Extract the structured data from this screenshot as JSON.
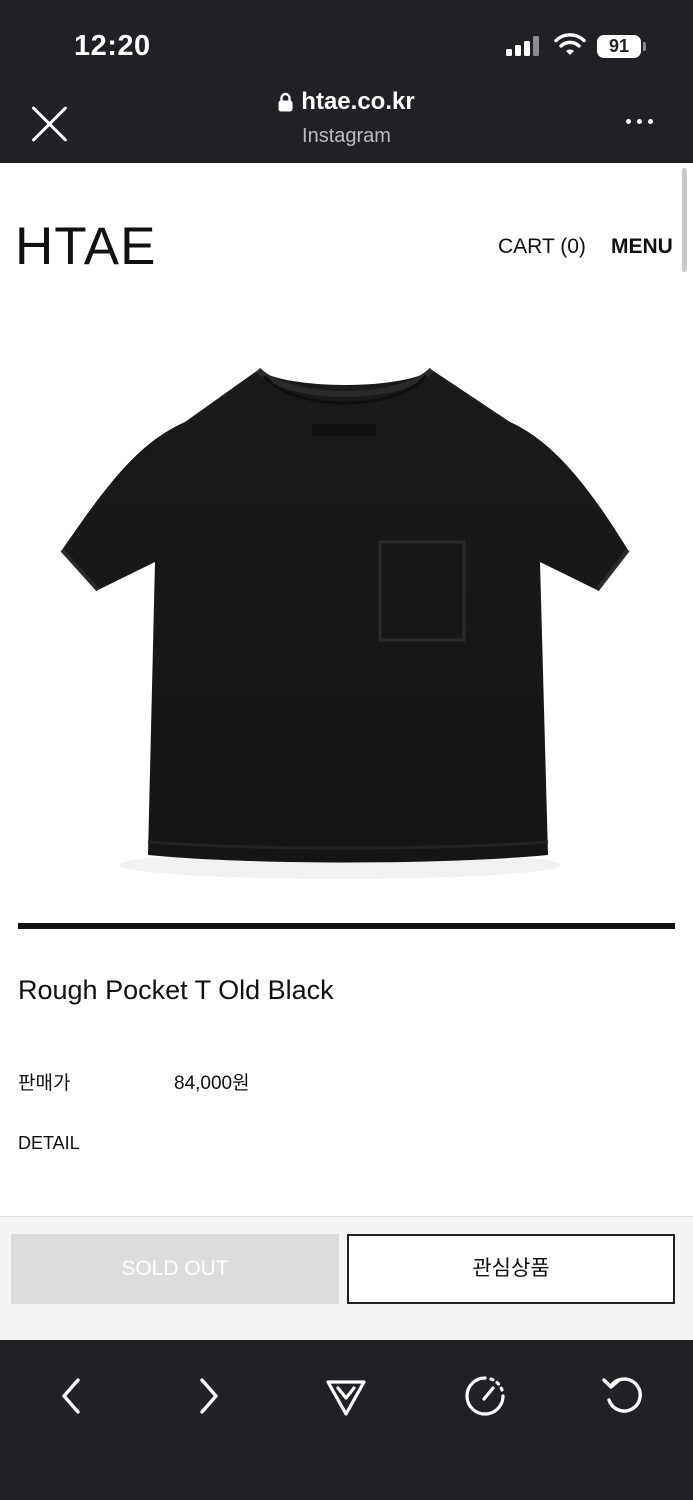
{
  "status_bar": {
    "time": "12:20",
    "battery": "91"
  },
  "browser": {
    "domain": "htae.co.kr",
    "source": "Instagram"
  },
  "site": {
    "logo": "HTAE",
    "cart": "CART (0)",
    "menu": "MENU"
  },
  "product": {
    "name": "Rough Pocket T Old Black",
    "price_label": "판매가",
    "price": "84,000원",
    "detail": "DETAIL",
    "image_icon": "black-pocket-tshirt"
  },
  "actions": {
    "sold_out": "SOLD OUT",
    "wishlist": "관심상품"
  },
  "toolbar": {
    "back_icon": "chevron-left-icon",
    "forward_icon": "chevron-right-icon",
    "share_icon": "send-icon",
    "speed_icon": "speedometer-icon",
    "reload_icon": "reload-icon"
  },
  "colors": {
    "chrome": "#1f2125",
    "sold_out_bg": "#dcdcde",
    "text": "#111111"
  }
}
